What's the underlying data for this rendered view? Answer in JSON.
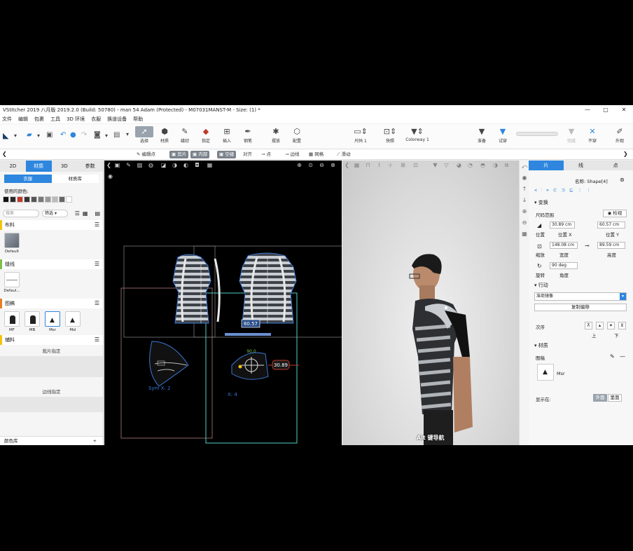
{
  "window": {
    "title": "VStitcher 2019 八月版 2019.2.0 (Build: 50780) - man 54 Adam (Protected) - M07031MANST-M - Size: (1) *",
    "controls": [
      "—",
      "▢",
      "✕"
    ]
  },
  "menu": [
    "文件",
    "编辑",
    "包裹",
    "工具",
    "3D 环境",
    "衣服",
    "换道设备",
    "帮助"
  ],
  "toolbar": {
    "tools": [
      {
        "label": "选择",
        "icon": "arrow-icon"
      },
      {
        "label": "材质",
        "icon": "material-icon"
      },
      {
        "label": "缝纫",
        "icon": "needle-icon"
      },
      {
        "label": "指定",
        "icon": "assign-icon"
      },
      {
        "label": "插入",
        "icon": "insert-icon"
      },
      {
        "label": "钢笔",
        "icon": "pen-icon"
      },
      {
        "label": "摆放",
        "icon": "pose-icon"
      },
      {
        "label": "配置",
        "icon": "config-icon"
      },
      {
        "label": "尺码 1",
        "icon": "size-icon"
      },
      {
        "label": "快照",
        "icon": "snapshot-icon"
      },
      {
        "label": "Colorway 1",
        "icon": "colorway-icon"
      },
      {
        "label": "准备",
        "icon": "prepare-icon"
      },
      {
        "label": "试穿",
        "icon": "tryon-icon"
      },
      {
        "label": "完成",
        "icon": "done-icon"
      },
      {
        "label": "不穿",
        "icon": "undress-icon"
      },
      {
        "label": "外观",
        "icon": "appearance-icon"
      }
    ]
  },
  "subbar": {
    "edit_points": "编辑点",
    "cut": "剪片",
    "inner": "内部",
    "dotted": "空缝",
    "align": "对齐",
    "point": "点",
    "edge": "边线",
    "grid": "网格",
    "flow": "滑动"
  },
  "left": {
    "tabs": [
      "2D",
      "材质",
      "3D",
      "参数"
    ],
    "active_tab": "材质",
    "subtabs": [
      "衣服",
      "材质库"
    ],
    "used_colors_label": "使用的颜色:",
    "colors": [
      "#111111",
      "#2a2a2a",
      "#c0392b",
      "#333333",
      "#555555",
      "#777777",
      "#999999",
      "#bbbbbb",
      "#666666",
      "#ffffff"
    ],
    "search_placeholder": "搜索",
    "filter_label": "筛选",
    "sections": {
      "fabric": {
        "title": "布料",
        "items": [
          {
            "name": "Default"
          }
        ]
      },
      "stitch": {
        "title": "缝线",
        "items": [
          {
            "name": "Defaul..."
          }
        ]
      },
      "artwork": {
        "title": "图稿",
        "items": [
          {
            "name": "MF"
          },
          {
            "name": "MB"
          },
          {
            "name": "Msr"
          },
          {
            "name": "Msl"
          }
        ]
      },
      "trims": {
        "title": "辅料"
      },
      "piece_assign": "裁片指定",
      "edge_assign": "边线指定",
      "color_lib": "颜色库"
    }
  },
  "view2d": {
    "measure_top": "60.57",
    "measure_right": "30.89",
    "angle": "90.0",
    "sym_label": "Sym X: 2",
    "x_label": "X: 4"
  },
  "view3d": {
    "nav_hint": "Alt 键导航"
  },
  "right": {
    "tabs": [
      "片",
      "线",
      "点"
    ],
    "name_label": "名称: Shape[4]",
    "transform_title": "变换",
    "size_range": "尺码范围",
    "check_view": "检视",
    "pos_x_value": "30.89",
    "pos_x_unit": "cm",
    "pos_x_label": "位置 X",
    "pos_y_value": "60.57",
    "pos_y_unit": "cm",
    "pos_y_label": "位置 Y",
    "pos_label": "位置",
    "width_value": "148.08",
    "width_unit": "cm",
    "width_label": "宽度",
    "height_value": "89.59",
    "height_unit": "cm",
    "height_label": "高度",
    "scale_label": "缩放",
    "rotate_value": "90",
    "rotate_unit": "deg",
    "rotate_label": "旋转",
    "angle_label": "角度",
    "action_title": "行动",
    "mirror_option": "准商镜像",
    "copy_offset": "复制偏移",
    "order_label": "次序",
    "order_up": "上",
    "order_top": "下",
    "material_title": "材质",
    "artwork_label": "图稿",
    "artwork_name": "Msr",
    "show_on": "显示在:",
    "outside": "外面",
    "inside": "里面"
  }
}
